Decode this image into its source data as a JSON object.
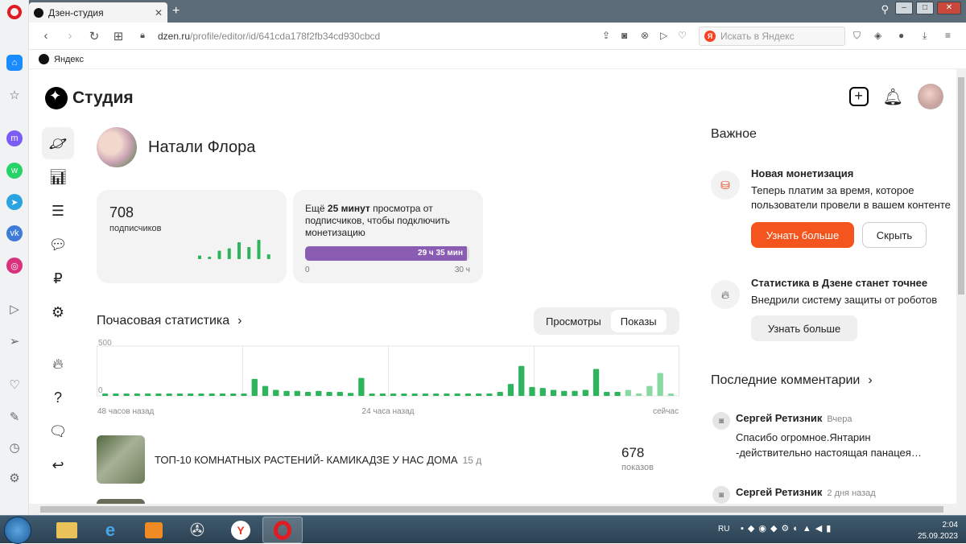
{
  "browser": {
    "tab_title": "Дзен-студия",
    "url_host": "dzen.ru",
    "url_path": "/profile/editor/id/641cda178f2fb34cd930cbcd",
    "search_placeholder": "Искать в Яндекс",
    "bookmark": "Яндекс"
  },
  "studio": {
    "logo_text": "Студия",
    "channel_name": "Натали Флора"
  },
  "subscribers": {
    "count": "708",
    "label": "подписчиков",
    "trend": [
      0.15,
      0.08,
      0.35,
      0.45,
      0.7,
      0.5,
      0.8,
      0.2
    ]
  },
  "monetization": {
    "text_prefix": "Ещё ",
    "text_bold": "25 минут",
    "text_suffix": " просмотра от подписчиков, чтобы подключить монетизацию",
    "progress_label": "29 ч 35 мин",
    "progress_fraction": 0.986,
    "min_label": "0",
    "max_label": "30 ч"
  },
  "hourly": {
    "title": "Почасовая статистика",
    "toggle": [
      "Просмотры",
      "Показы"
    ],
    "toggle_active": 1
  },
  "chart_data": {
    "type": "bar",
    "title": "Почасовая статистика",
    "ylim": [
      0,
      500
    ],
    "y_ticks": [
      "500",
      "0"
    ],
    "x_tick_labels": [
      "48 часов назад",
      "24 часа назад",
      "сейчас"
    ],
    "values": [
      20,
      20,
      20,
      20,
      20,
      20,
      20,
      20,
      20,
      20,
      20,
      20,
      20,
      20,
      170,
      100,
      60,
      50,
      50,
      40,
      50,
      40,
      40,
      30,
      180,
      20,
      20,
      20,
      20,
      20,
      20,
      20,
      20,
      20,
      20,
      20,
      20,
      40,
      120,
      300,
      90,
      80,
      60,
      50,
      50,
      60,
      270,
      40,
      40,
      60,
      20,
      100,
      230,
      20
    ],
    "recent_from_index": 49
  },
  "articles": [
    {
      "title": "ТОП-10 КОМНАТНЫХ РАСТЕНИЙ- КАМИКАДЗЕ У НАС ДОМА",
      "age": "15 д",
      "views": "678",
      "views_label": "показов"
    }
  ],
  "important": {
    "title": "Важное",
    "items": [
      {
        "title": "Новая монетизация",
        "desc": "Теперь платим за время, которое пользователи провели в вашем контенте",
        "primary": "Узнать больше",
        "secondary": "Скрыть"
      },
      {
        "title": "Статистика в Дзене станет точнее",
        "desc": "Внедрили систему защиты от роботов",
        "primary": "Узнать больше"
      }
    ]
  },
  "comments": {
    "title": "Последние комментарии",
    "items": [
      {
        "author": "Сергей Ретизник",
        "date": "Вчера",
        "text": "Спасибо огромное.Янтарин -действительно настоящая панацея…"
      },
      {
        "author": "Сергей Ретизник",
        "date": "2 дня назад",
        "text": ""
      }
    ]
  },
  "taskbar": {
    "lang": "RU",
    "time": "2:04",
    "date": "25.09.2023"
  },
  "colors": {
    "accent": "#f4541d",
    "bar_green": "#2db45c",
    "bar_light_green": "#8ad9a3",
    "progress_purple": "#8a5cb2"
  }
}
